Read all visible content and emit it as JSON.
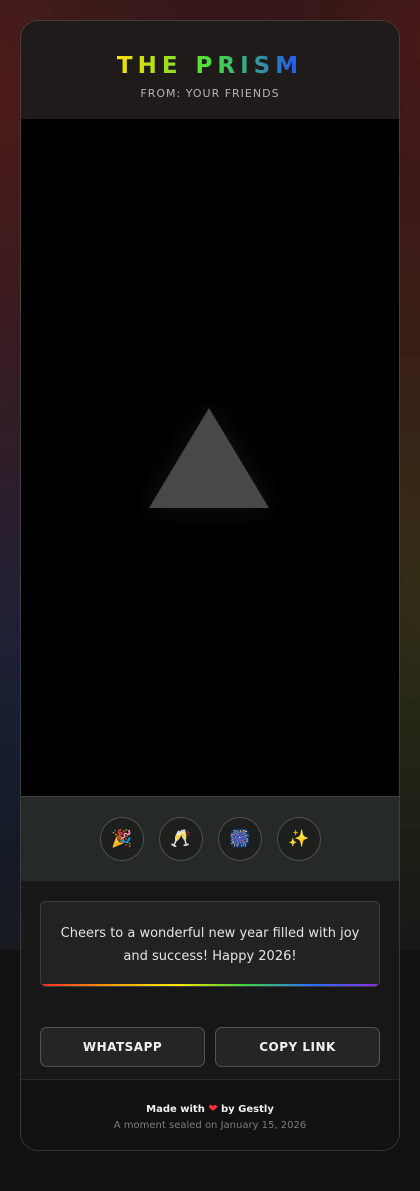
{
  "header": {
    "title": "THE PRISM",
    "subtitle": "FROM: YOUR FRIENDS"
  },
  "reactions": [
    {
      "icon": "party-popper-icon",
      "glyph": "🎉"
    },
    {
      "icon": "clinking-glasses-icon",
      "glyph": "🥂"
    },
    {
      "icon": "fireworks-icon",
      "glyph": "🎆"
    },
    {
      "icon": "sparkles-icon",
      "glyph": "✨"
    }
  ],
  "message": {
    "text": "Cheers to a wonderful new year filled with joy and success! Happy 2026!"
  },
  "actions": {
    "whatsapp_label": "WHATSAPP",
    "copy_link_label": "COPY LINK"
  },
  "footer": {
    "made_with_prefix": "Made with",
    "heart": "❤",
    "made_with_suffix": "by Gestly",
    "sealed": "A moment sealed on January 15, 2026"
  },
  "colors": {
    "heart": "#ff2d3d",
    "prism": "#484848"
  }
}
